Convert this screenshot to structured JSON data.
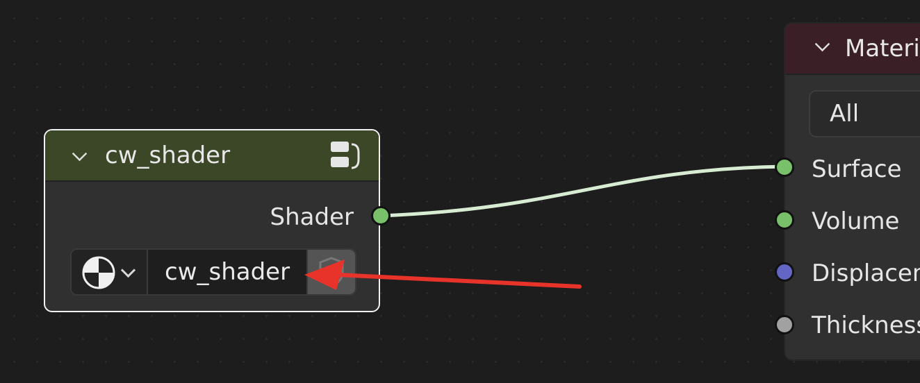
{
  "group_node": {
    "title": "cw_shader",
    "output_socket": {
      "label": "Shader",
      "color": "#78c06a"
    },
    "datablock": {
      "name": "cw_shader"
    },
    "header_color": "#3c4728"
  },
  "material_output_node": {
    "title": "Materia",
    "target": "All",
    "header_color": "#3b1f26",
    "inputs": [
      {
        "label": "Surface",
        "color": "#78c06a"
      },
      {
        "label": "Volume",
        "color": "#78c06a"
      },
      {
        "label": "Displacem",
        "color": "#6466c6"
      },
      {
        "label": "Thickness",
        "color": "#a1a1a1"
      }
    ]
  },
  "link": {
    "color": "#d8ecd4"
  },
  "annotation": {
    "arrow_color": "#e8332a"
  }
}
